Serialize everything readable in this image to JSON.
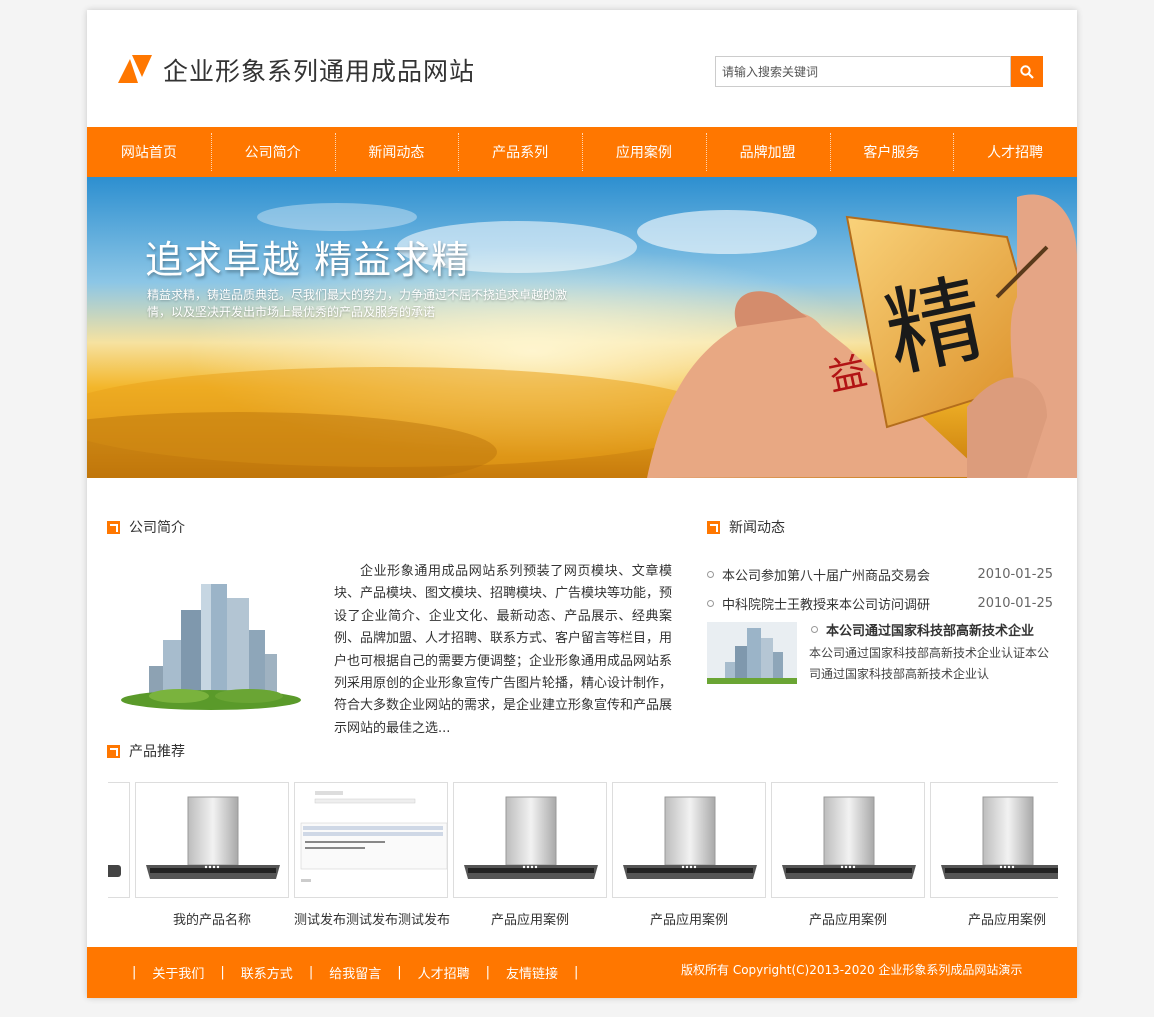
{
  "header": {
    "site_title": "企业形象系列通用成品网站",
    "search_placeholder": "请输入搜索关键词",
    "logo_icon": "orange-logo-icon",
    "search_icon": "search-icon"
  },
  "nav": {
    "items": [
      "网站首页",
      "公司简介",
      "新闻动态",
      "产品系列",
      "应用案例",
      "品牌加盟",
      "客户服务",
      "人才招聘"
    ]
  },
  "banner": {
    "title": "追求卓越 精益求精",
    "description": "精益求精，铸造品质典范。尽我们最大的努力，力争通过不屈不挠追求卓越的激情，以及坚决开发出市场上最优秀的产品及服务的承诺"
  },
  "about": {
    "heading": "公司简介",
    "text": "企业形象通用成品网站系列预装了网页模块、文章模块、产品模块、图文模块、招聘模块、广告模块等功能，预设了企业简介、企业文化、最新动态、产品展示、经典案例、品牌加盟、人才招聘、联系方式、客户留言等栏目，用户也可根据自己的需要方便调整；企业形象通用成品网站系列采用原创的企业形象宣传广告图片轮播，精心设计制作，符合大多数企业网站的需求，是企业建立形象宣传和产品展示网站的最佳之选..."
  },
  "news": {
    "heading": "新闻动态",
    "items": [
      {
        "title": "本公司参加第八十届广州商品交易会",
        "date": "2010-01-25"
      },
      {
        "title": "中科院院士王教授来本公司访问调研",
        "date": "2010-01-25"
      }
    ],
    "feature": {
      "title": "本公司通过国家科技部高新技术企业",
      "text": "本公司通过国家科技部高新技术企业认证本公司通过国家科技部高新技术企业认"
    }
  },
  "products": {
    "heading": "产品推荐",
    "items": [
      {
        "name": "我的产品名称",
        "kind": "range-hood"
      },
      {
        "name": "测试发布测试发布测试发布",
        "kind": "form-screenshot"
      },
      {
        "name": "产品应用案例",
        "kind": "range-hood"
      },
      {
        "name": "产品应用案例",
        "kind": "range-hood"
      },
      {
        "name": "产品应用案例",
        "kind": "range-hood"
      },
      {
        "name": "产品应用案例",
        "kind": "range-hood"
      }
    ]
  },
  "footer": {
    "links": [
      "关于我们",
      "联系方式",
      "给我留言",
      "人才招聘",
      "友情链接"
    ],
    "separator": "|",
    "copyright": "版权所有 Copyright(C)2013-2020 企业形象系列成品网站演示"
  },
  "colors": {
    "accent": "#ff7700",
    "text": "#333333"
  }
}
